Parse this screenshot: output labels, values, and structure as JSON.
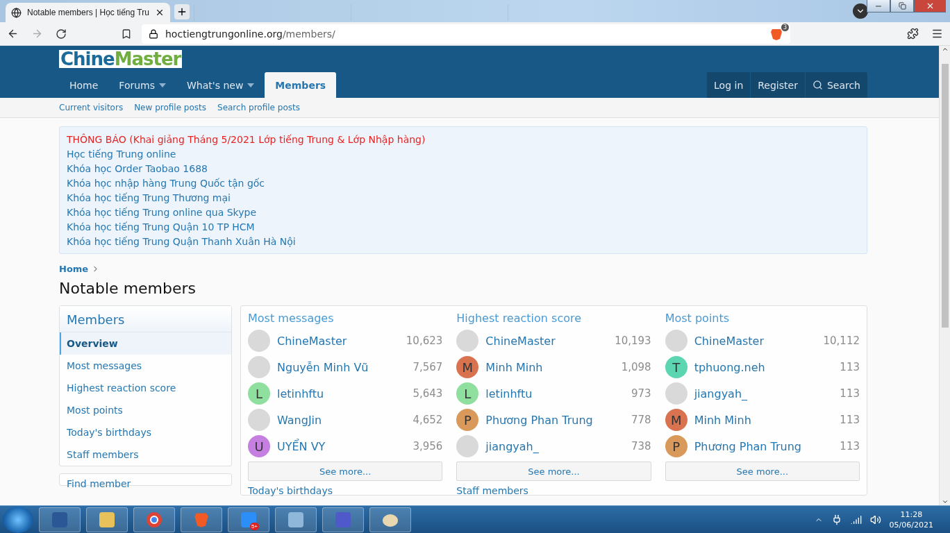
{
  "browser": {
    "tab_title": "Notable members | Học tiếng Tru",
    "address_host": "hoctiengtrungonline.org",
    "address_path": "/members/",
    "shield_count": "3"
  },
  "logo": {
    "part1": "Chine",
    "part2": "Master"
  },
  "nav": [
    {
      "label": "Home",
      "dropdown": false,
      "selected": false
    },
    {
      "label": "Forums",
      "dropdown": true,
      "selected": false
    },
    {
      "label": "What's new",
      "dropdown": true,
      "selected": false
    },
    {
      "label": "Members",
      "dropdown": false,
      "selected": true
    }
  ],
  "nav_right": [
    "Log in",
    "Register",
    "Search"
  ],
  "subnav": [
    "Current visitors",
    "New profile posts",
    "Search profile posts"
  ],
  "notice": [
    {
      "text": "THÔNG BÁO (Khai giảng Tháng 5/2021 Lớp tiếng Trung & Lớp Nhập hàng)",
      "kind": "alert"
    },
    {
      "text": "Học tiếng Trung online",
      "kind": "link"
    },
    {
      "text": "Khóa học Order Taobao 1688",
      "kind": "link"
    },
    {
      "text": "Khóa học nhập hàng Trung Quốc tận gốc",
      "kind": "link"
    },
    {
      "text": "Khóa học tiếng Trung Thương mại",
      "kind": "link"
    },
    {
      "text": "Khóa học tiếng Trung online qua Skype",
      "kind": "link"
    },
    {
      "text": "Khóa học tiếng Trung Quận 10 TP HCM",
      "kind": "link"
    },
    {
      "text": "Khóa học tiếng Trung Quận Thanh Xuân Hà Nội",
      "kind": "link"
    }
  ],
  "breadcrumb": "Home",
  "page_title": "Notable members",
  "sidebar": {
    "title": "Members",
    "items": [
      {
        "label": "Overview",
        "selected": true
      },
      {
        "label": "Most messages",
        "selected": false
      },
      {
        "label": "Highest reaction score",
        "selected": false
      },
      {
        "label": "Most points",
        "selected": false
      },
      {
        "label": "Today's birthdays",
        "selected": false
      },
      {
        "label": "Staff members",
        "selected": false
      }
    ],
    "next_title": "Find member"
  },
  "lists": [
    {
      "title": "Most messages",
      "more": "See more...",
      "members": [
        {
          "name": "ChineMaster",
          "value": "10,623",
          "avatar": {
            "kind": "photo"
          }
        },
        {
          "name": "Nguyễn Minh Vũ",
          "value": "7,567",
          "avatar": {
            "kind": "photo"
          }
        },
        {
          "name": "letinhftu",
          "value": "5,643",
          "avatar": {
            "kind": "letter",
            "letter": "L",
            "color": "#8fdf9e"
          }
        },
        {
          "name": "WangJin",
          "value": "4,652",
          "avatar": {
            "kind": "photo"
          }
        },
        {
          "name": "UYỂN VY",
          "value": "3,956",
          "avatar": {
            "kind": "letter",
            "letter": "U",
            "color": "#c47fe0"
          }
        }
      ]
    },
    {
      "title": "Highest reaction score",
      "more": "See more...",
      "members": [
        {
          "name": "ChineMaster",
          "value": "10,193",
          "avatar": {
            "kind": "photo"
          }
        },
        {
          "name": "Minh Minh",
          "value": "1,098",
          "avatar": {
            "kind": "letter",
            "letter": "M",
            "color": "#d9734f"
          }
        },
        {
          "name": "letinhftu",
          "value": "973",
          "avatar": {
            "kind": "letter",
            "letter": "L",
            "color": "#8fdf9e"
          }
        },
        {
          "name": "Phương Phan Trung",
          "value": "778",
          "avatar": {
            "kind": "letter",
            "letter": "P",
            "color": "#d9995a"
          }
        },
        {
          "name": "jiangyah_",
          "value": "738",
          "avatar": {
            "kind": "photo"
          }
        }
      ]
    },
    {
      "title": "Most points",
      "more": "See more...",
      "members": [
        {
          "name": "ChineMaster",
          "value": "10,112",
          "avatar": {
            "kind": "photo"
          }
        },
        {
          "name": "tphuong.neh",
          "value": "113",
          "avatar": {
            "kind": "letter",
            "letter": "T",
            "color": "#5cd6b0"
          }
        },
        {
          "name": "jiangyah_",
          "value": "113",
          "avatar": {
            "kind": "photo"
          }
        },
        {
          "name": "Minh Minh",
          "value": "113",
          "avatar": {
            "kind": "letter",
            "letter": "M",
            "color": "#d9734f"
          }
        },
        {
          "name": "Phương Phan Trung",
          "value": "113",
          "avatar": {
            "kind": "letter",
            "letter": "P",
            "color": "#d9995a"
          }
        }
      ]
    }
  ],
  "next_headings": [
    "Today's birthdays",
    "Staff members"
  ],
  "taskbar": {
    "zalo_badge": "5+",
    "time": "11:28",
    "date": "05/06/2021"
  }
}
